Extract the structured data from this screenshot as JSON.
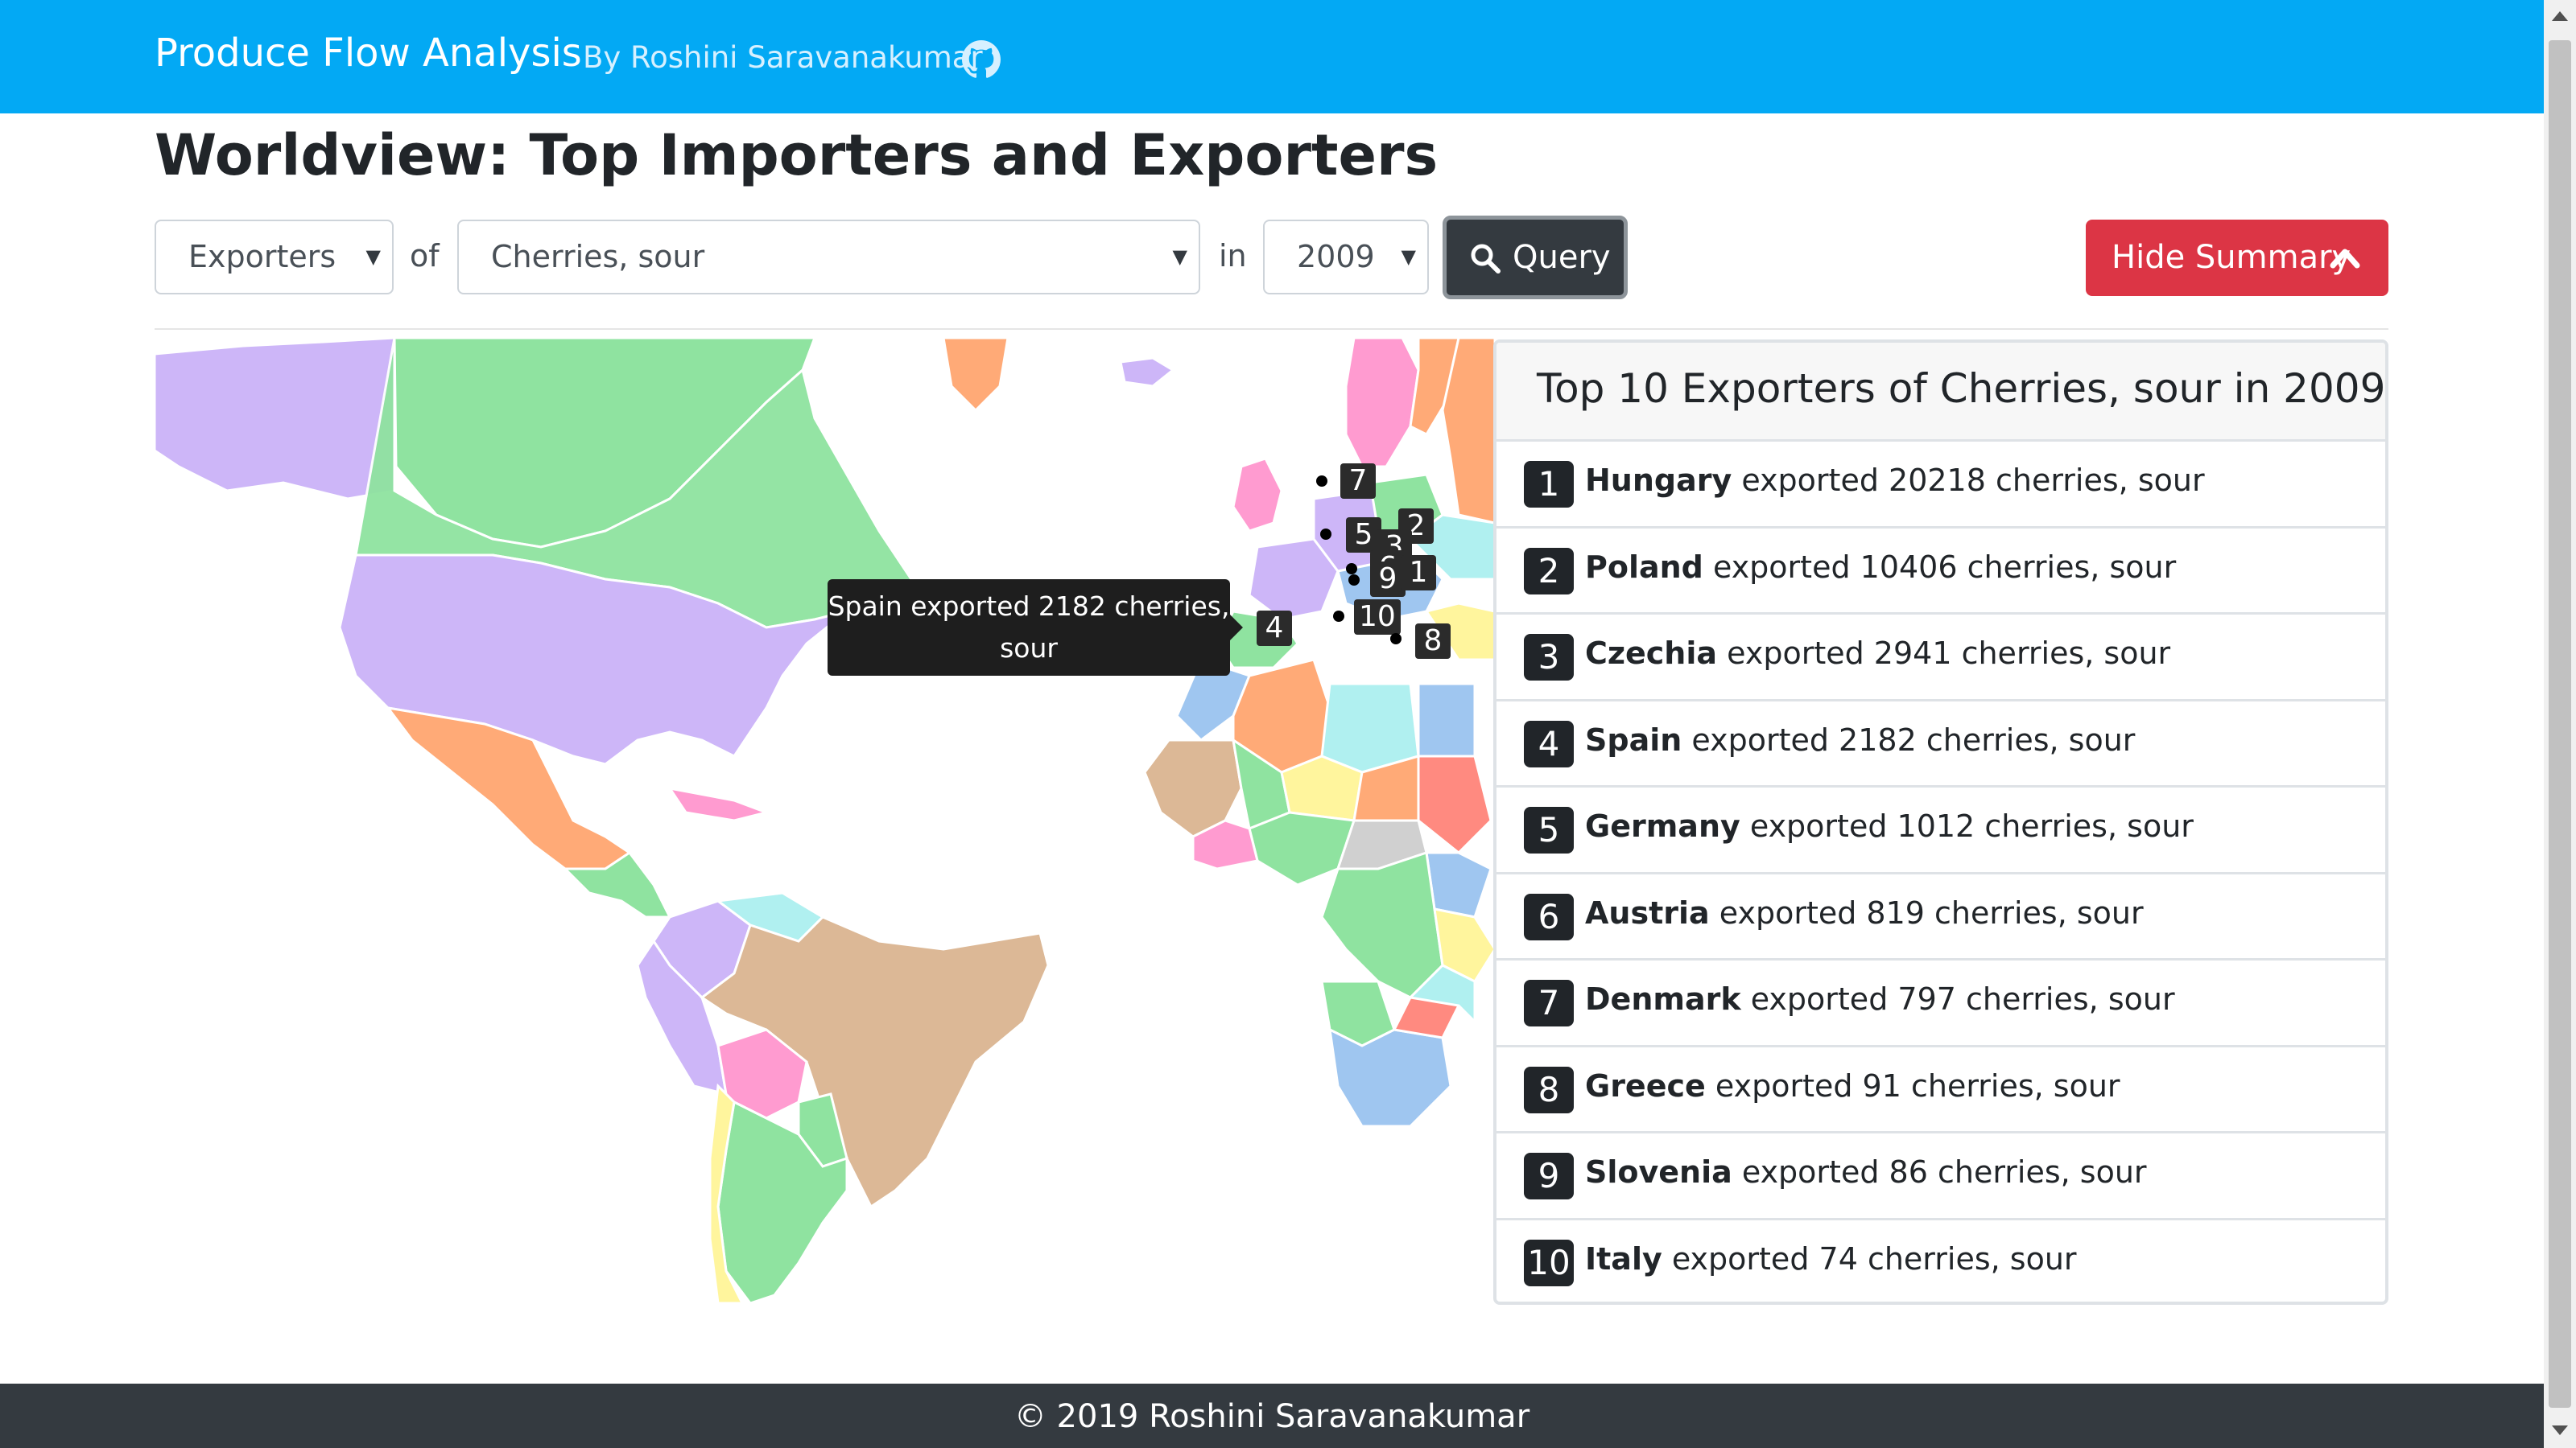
{
  "navbar": {
    "brand": "Produce Flow Analysis",
    "byline": "By Roshini Saravanakumar",
    "icon": "github-icon",
    "background": "#03a9f4"
  },
  "page_title": "Worldview: Top Importers and Exporters",
  "query": {
    "type_select": "Exporters",
    "of_label": "of",
    "product_select": "Cherries, sour",
    "in_label": "in",
    "year_select": "2009",
    "query_button": "Query",
    "query_icon": "search-icon"
  },
  "summary_button": {
    "label": "Hide Summary",
    "icon": "chevron-up-icon",
    "color": "#dc3545"
  },
  "map": {
    "tooltip": "Spain exported 2182 cherries, sour",
    "markers": [
      "1",
      "2",
      "3",
      "4",
      "5",
      "6",
      "7",
      "8",
      "9",
      "10"
    ]
  },
  "summary": {
    "title": "Top 10 Exporters of Cherries, sour in 2009",
    "items": [
      {
        "rank": "1",
        "country": "Hungary",
        "text": "exported 20218 cherries, sour"
      },
      {
        "rank": "2",
        "country": "Poland",
        "text": "exported 10406 cherries, sour"
      },
      {
        "rank": "3",
        "country": "Czechia",
        "text": "exported 2941 cherries, sour"
      },
      {
        "rank": "4",
        "country": "Spain",
        "text": "exported 2182 cherries, sour"
      },
      {
        "rank": "5",
        "country": "Germany",
        "text": "exported 1012 cherries, sour"
      },
      {
        "rank": "6",
        "country": "Austria",
        "text": "exported 819 cherries, sour"
      },
      {
        "rank": "7",
        "country": "Denmark",
        "text": "exported 797 cherries, sour"
      },
      {
        "rank": "8",
        "country": "Greece",
        "text": "exported 91 cherries, sour"
      },
      {
        "rank": "9",
        "country": "Slovenia",
        "text": "exported 86 cherries, sour"
      },
      {
        "rank": "10",
        "country": "Italy",
        "text": "exported 74 cherries, sour"
      }
    ]
  },
  "footer": "© 2019 Roshini Saravanakumar"
}
